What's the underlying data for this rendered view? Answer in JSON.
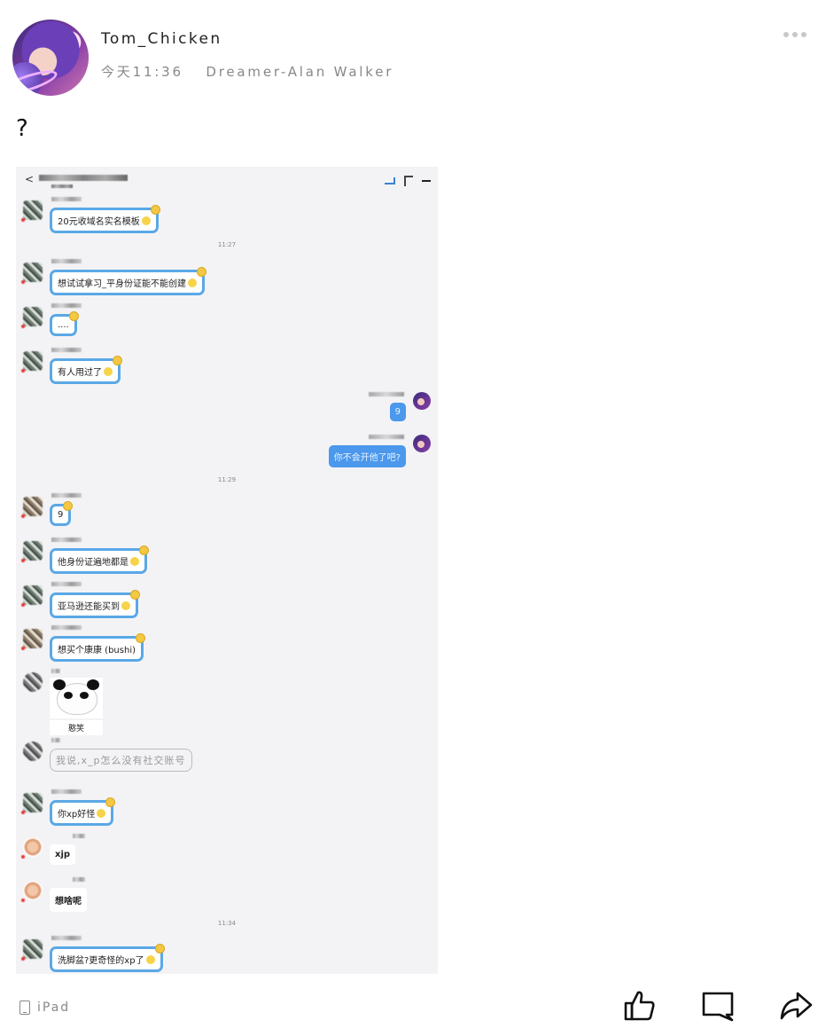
{
  "post": {
    "username": "Tom_Chicken",
    "time": "今天11:36",
    "song": "Dreamer-Alan Walker",
    "text": "?",
    "device": "iPad"
  },
  "chat": {
    "messages": [
      {
        "side": "left",
        "text": "20元收域名实名模板"
      },
      {
        "side": "time",
        "text": "11:27"
      },
      {
        "side": "left",
        "text": "想试试拿习_平身份证能不能创建"
      },
      {
        "side": "left",
        "text": "...."
      },
      {
        "side": "left",
        "text": "有人用过了"
      },
      {
        "side": "right",
        "text": "9"
      },
      {
        "side": "right",
        "text": "你不会开他了吧?"
      },
      {
        "side": "time",
        "text": "11:29"
      },
      {
        "side": "left",
        "text": "9"
      },
      {
        "side": "left",
        "text": "他身份证遍地都是"
      },
      {
        "side": "left",
        "text": "亚马逊还能买到"
      },
      {
        "side": "left",
        "text": "想买个康康 (bushi)"
      },
      {
        "side": "left",
        "text": "憨笑"
      },
      {
        "side": "left",
        "text": "我说,x_p怎么没有社交账号"
      },
      {
        "side": "left",
        "text": "你xp好怪"
      },
      {
        "side": "left",
        "text": "xjp"
      },
      {
        "side": "left",
        "text": "想啥呢"
      },
      {
        "side": "time",
        "text": "11:34"
      },
      {
        "side": "left",
        "text": "洗脚盆?更奇怪的xp了"
      }
    ]
  },
  "icons": {
    "more": "more-dots-icon",
    "like": "thumbs-up-icon",
    "comment": "comment-icon",
    "share": "share-icon",
    "device": "ipad-icon"
  },
  "colors": {
    "bubble_border": "#5aa8e6",
    "self_bubble": "#4b98ec",
    "meta_grey": "#888888"
  }
}
